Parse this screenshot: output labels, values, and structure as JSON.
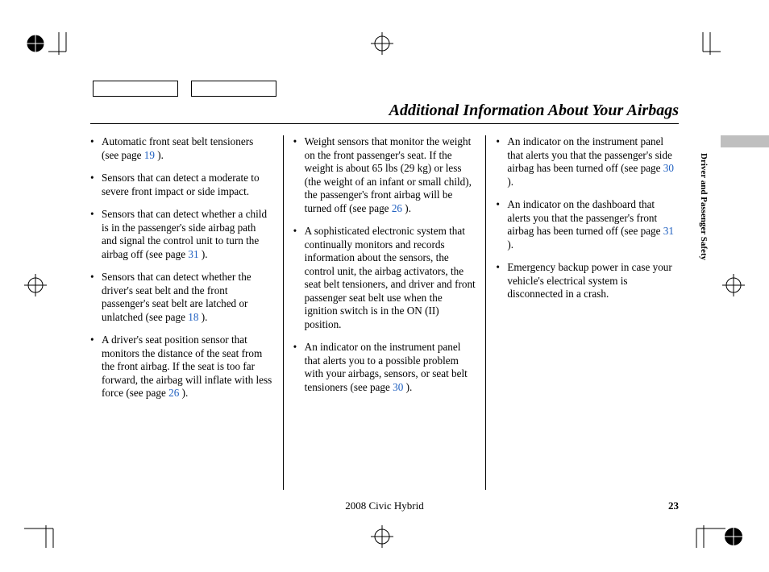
{
  "title": "Additional Information About Your Airbags",
  "side_label": "Driver and Passenger Safety",
  "footer_model": "2008  Civic  Hybrid",
  "page_number": "23",
  "col1": {
    "i1a": "Automatic front seat belt tensioners (see page ",
    "i1p": "19",
    "i1b": " ).",
    "i2": "Sensors that can detect a moderate to severe front impact or side impact.",
    "i3a": "Sensors that can detect whether a child is in the passenger's side airbag path and signal the control unit to turn the airbag off (see page ",
    "i3p": "31",
    "i3b": " ).",
    "i4a": "Sensors that can detect whether the driver's seat belt and the front passenger's seat belt are latched or unlatched (see page ",
    "i4p": "18",
    "i4b": " ).",
    "i5a": "A driver's seat position sensor that monitors the distance of the seat from the front airbag. If the seat is too far forward, the airbag will inflate with less force (see page ",
    "i5p": "26",
    "i5b": " )."
  },
  "col2": {
    "i1a": "Weight sensors that monitor the weight on the front passenger's seat. If the weight is about 65 lbs (29 kg) or less (the weight of an infant or small child), the passenger's front airbag will be turned off (see page ",
    "i1p": "26",
    "i1b": " ).",
    "i2": "A sophisticated electronic system that continually monitors and records information about the sensors, the control unit, the airbag activators, the seat belt tensioners, and driver and front passenger seat belt use when the ignition switch is in the ON (II) position.",
    "i3a": "An indicator on the instrument panel that alerts you to a possible problem with your airbags, sensors, or seat belt tensioners (see page ",
    "i3p": "30",
    "i3b": " )."
  },
  "col3": {
    "i1a": "An indicator on the instrument panel that alerts you that the passenger's side airbag has been turned off (see page ",
    "i1p": "30",
    "i1b": " ).",
    "i2a": "An indicator on the dashboard that alerts you that the passenger's front airbag has been turned off (see page ",
    "i2p": "31",
    "i2b": " ).",
    "i3": "Emergency backup power in case your vehicle's electrical system is disconnected in a crash."
  }
}
